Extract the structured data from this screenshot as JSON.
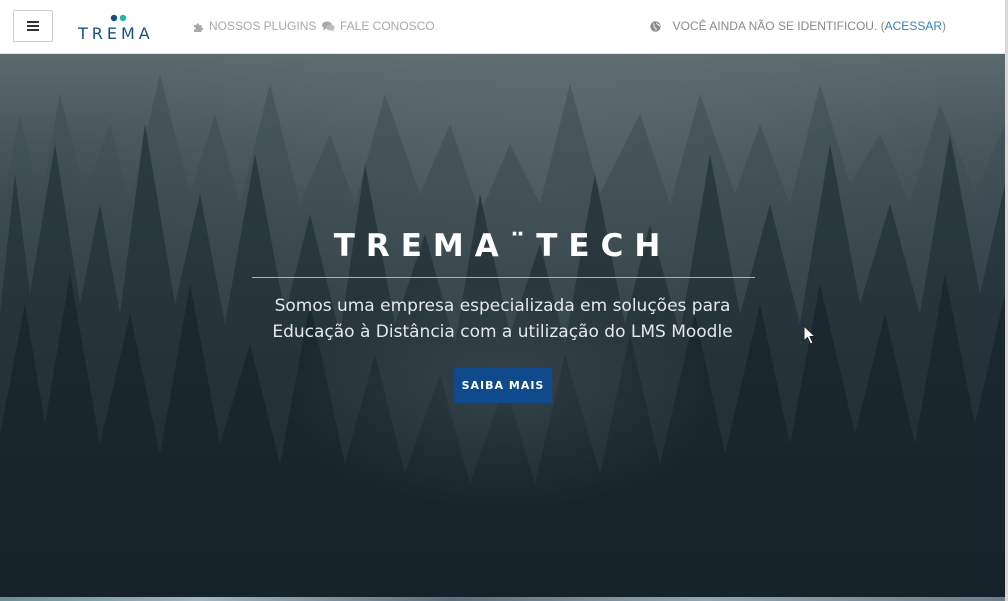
{
  "navbar": {
    "menu_icon": "hamburger-icon",
    "logo_text": "TREMA",
    "logo_dot_colors": [
      "#1a4f86",
      "#25b4a8"
    ],
    "links": [
      {
        "label": "NOSSOS PLUGINS",
        "icon": "puzzle-icon"
      },
      {
        "label": "FALE CONOSCO",
        "icon": "chat-bubbles-icon"
      }
    ],
    "login": {
      "icon": "globe-icon",
      "text": "VOCÊ AINDA NÃO SE IDENTIFICOU. (",
      "link_label": "ACESSAR",
      "suffix": ")"
    }
  },
  "hero": {
    "title": "TREMA¨TECH",
    "subtitle_line1": "Somos uma empresa especializada em soluções para",
    "subtitle_line2": "Educação à Distância com a utilização do LMS Moodle",
    "button_label": "SAIBA MAIS"
  },
  "colors": {
    "brand_blue": "#1a4f86",
    "brand_teal": "#25b4a8",
    "button_blue": "#0e4a8c",
    "link_blue": "#3d7fb8",
    "nav_text": "#a8a8a8"
  }
}
